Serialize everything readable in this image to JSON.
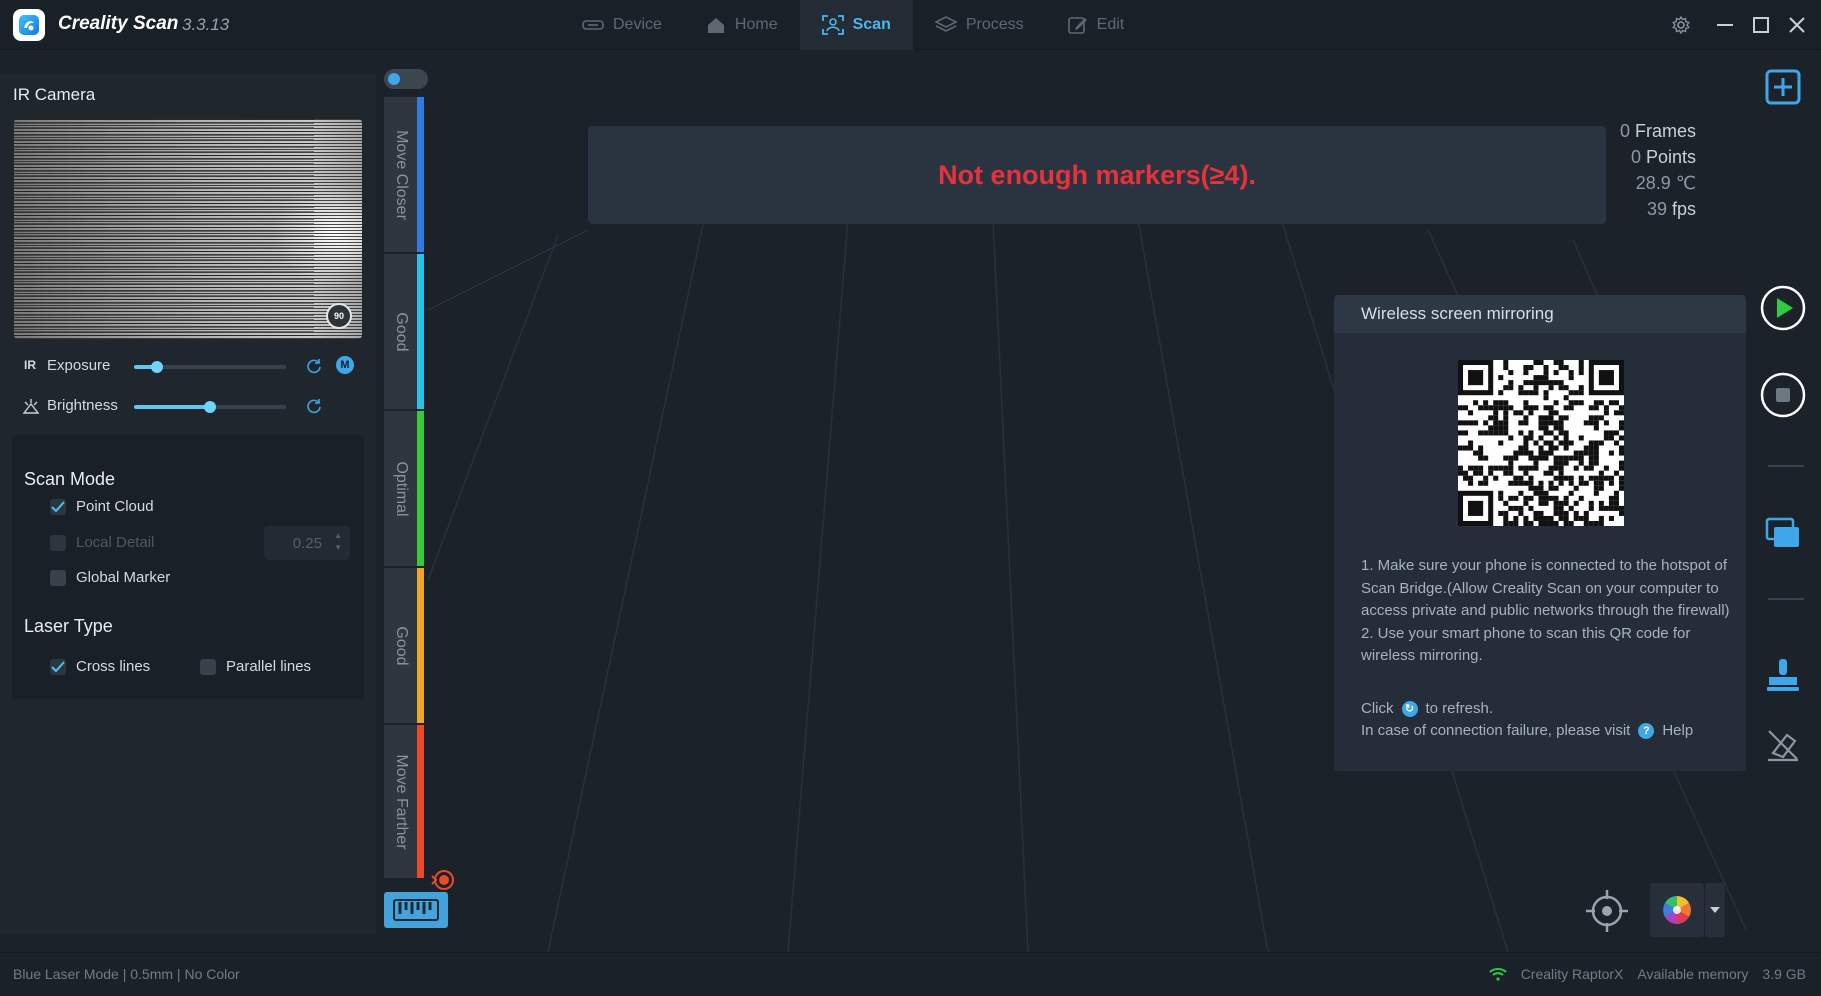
{
  "app": {
    "name": "Creality Scan",
    "version": "3.3.13"
  },
  "nav": {
    "tabs": [
      {
        "label": "Device",
        "icon": "device-icon"
      },
      {
        "label": "Home",
        "icon": "home-icon"
      },
      {
        "label": "Scan",
        "icon": "scan-icon",
        "active": true
      },
      {
        "label": "Process",
        "icon": "layers-icon"
      },
      {
        "label": "Edit",
        "icon": "edit-icon"
      }
    ]
  },
  "left_panel": {
    "ir_camera_title": "IR Camera",
    "rotate_label": "90",
    "exposure": {
      "prefix": "IR",
      "label": "Exposure",
      "value_fraction": 0.15,
      "mode_badge": "M"
    },
    "brightness": {
      "label": "Brightness",
      "value_fraction": 0.5
    },
    "scan_mode": {
      "title": "Scan Mode",
      "point_cloud": {
        "label": "Point Cloud",
        "checked": true
      },
      "local_detail": {
        "label": "Local Detail",
        "checked": false,
        "disabled": true,
        "value": "0.25"
      },
      "global_marker": {
        "label": "Global Marker",
        "checked": false
      }
    },
    "laser_type": {
      "title": "Laser Type",
      "cross_lines": {
        "label": "Cross lines",
        "checked": true
      },
      "parallel_lines": {
        "label": "Parallel lines",
        "checked": false
      }
    }
  },
  "distance_gauge": {
    "segments": [
      {
        "label": "Move Closer",
        "color": "#2f7ce0"
      },
      {
        "label": "Good",
        "color": "#28c3ea"
      },
      {
        "label": "Optimal",
        "color": "#39c93b"
      },
      {
        "label": "Good",
        "color": "#f0a62a"
      },
      {
        "label": "Move Farther",
        "color": "#ea4a26"
      }
    ]
  },
  "viewport": {
    "warning": "Not enough markers(≥4).",
    "stats": {
      "frames_value": "0",
      "frames_label": "Frames",
      "points_value": "0",
      "points_label": "Points",
      "temperature": "28.9 ℃",
      "fps_value": "39",
      "fps_label": "fps"
    }
  },
  "mirroring": {
    "title": "Wireless screen mirroring",
    "instructions": "1. Make sure your phone is connected to the hotspot of Scan Bridge.(Allow Creality Scan on your computer to access private and public networks through the firewall)",
    "instructions2": "2. Use your smart phone to scan this QR code for wireless mirroring.",
    "click_prefix": "Click",
    "click_suffix": "to refresh.",
    "failure_text": "In case of connection failure, please visit",
    "help_label": "Help"
  },
  "status": {
    "left": "Blue Laser Mode | 0.5mm | No Color",
    "device": "Creality RaptorX",
    "memory_label": "Available memory",
    "memory_value": "3.9 GB"
  },
  "colors": {
    "accent": "#3ea6e9",
    "warning": "#e5323c",
    "play": "#2ecc40",
    "background": "#1b222a"
  }
}
